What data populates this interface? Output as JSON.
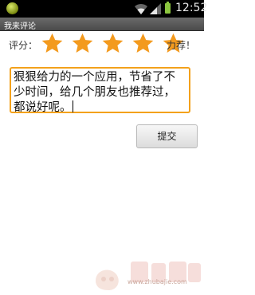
{
  "status_bar": {
    "time": "12:52",
    "icons": [
      "app-notification-icon",
      "wifi-icon",
      "signal-icon",
      "battery-icon"
    ],
    "battery_color": "#8cc63f"
  },
  "title_bar": {
    "title": "我来评论"
  },
  "rating": {
    "label": "评分：",
    "stars_filled": 5,
    "stars_total": 5,
    "level_text": "力荐！",
    "star_color": "#f39a1e"
  },
  "comment": {
    "value": "狠狠给力的一个应用，节省了不少时间，给几个朋友也推荐过，都说好呢。",
    "border_color": "#f3a11b"
  },
  "submit": {
    "label": "提交"
  },
  "watermark": {
    "text": "www.zhubajie.com"
  }
}
